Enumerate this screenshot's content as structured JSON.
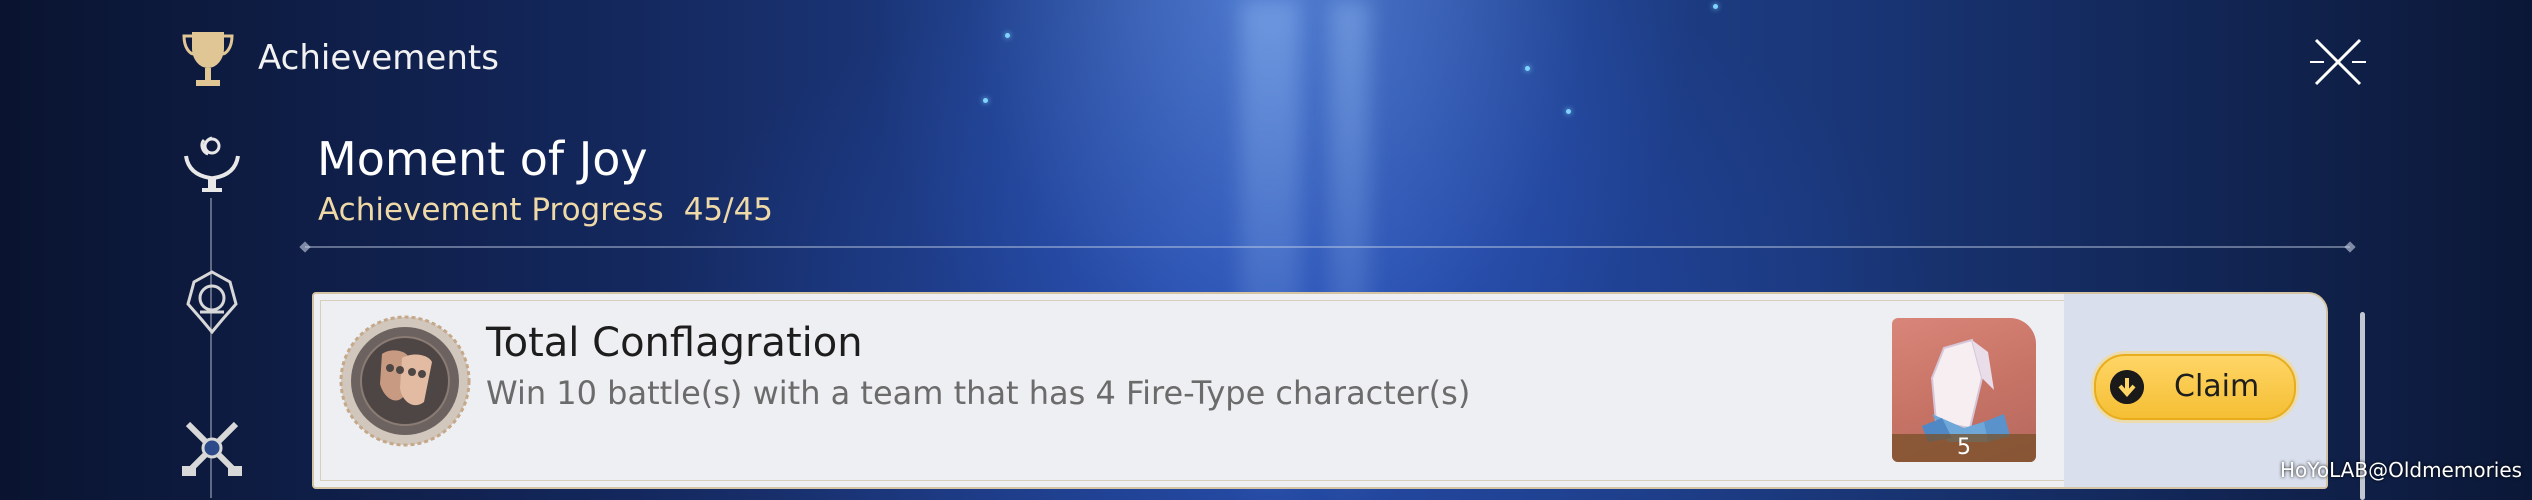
{
  "header": {
    "title": "Achievements",
    "trophy_icon": "trophy-icon",
    "close_icon": "close-icon"
  },
  "sidebar": {
    "items": [
      {
        "icon": "hands-moon-icon",
        "selected": true
      },
      {
        "icon": "helmet-emblem-icon",
        "selected": false
      },
      {
        "icon": "crossed-swords-icon",
        "selected": false
      }
    ]
  },
  "category": {
    "title": "Moment of Joy",
    "progress_label": "Achievement Progress",
    "progress_value": "45/45"
  },
  "achievement": {
    "title": "Total Conflagration",
    "description": "Win 10 battle(s) with a team that has 4 Fire-Type character(s)",
    "medal_icon": "theater-mask-medal-icon",
    "reward": {
      "icon": "crystal-icon",
      "count": "5"
    },
    "claim_label": "Claim",
    "claim_icon": "download-arrow-icon"
  },
  "watermark": "HoYoLAB@Oldmemories",
  "colors": {
    "accent_gold": "#efd9a7",
    "claim_button": "#f5bf34",
    "card_bg": "#eeeff2"
  }
}
